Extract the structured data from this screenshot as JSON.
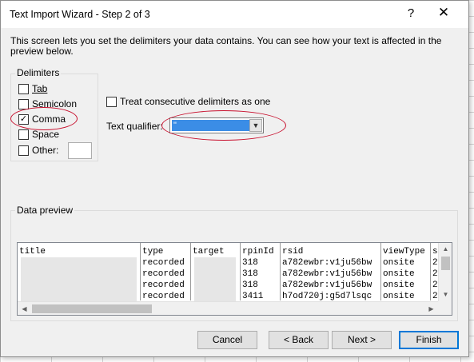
{
  "window": {
    "title": "Text Import Wizard - Step 2 of 3",
    "help_glyph": "?",
    "close_glyph": "✕"
  },
  "description": "This screen lets you set the delimiters your data contains.  You can see how your text is affected in the preview below.",
  "delimiters": {
    "legend": "Delimiters",
    "tab": {
      "label": "Tab",
      "checked": false
    },
    "semicolon": {
      "label": "Semicolon",
      "checked": false
    },
    "comma": {
      "label": "Comma",
      "checked": true
    },
    "space": {
      "label": "Space",
      "checked": false
    },
    "other": {
      "label": "Other:",
      "checked": false,
      "value": ""
    }
  },
  "consecutive": {
    "label": "Treat consecutive delimiters as one",
    "checked": false
  },
  "qualifier": {
    "label": "Text qualifier:",
    "value": "\""
  },
  "preview": {
    "legend": "Data preview",
    "columns": [
      "title",
      "type",
      "target",
      "rpinId",
      "rsid",
      "viewType",
      "s"
    ],
    "rows": [
      [
        "",
        "recorded",
        "",
        "318",
        "a782ewbr:v1ju56bw",
        "onsite",
        "2"
      ],
      [
        "",
        "recorded",
        "",
        "318",
        "a782ewbr:v1ju56bw",
        "onsite",
        "2"
      ],
      [
        "",
        "recorded",
        "",
        "318",
        "a782ewbr:v1ju56bw",
        "onsite",
        "2"
      ],
      [
        "",
        "recorded",
        "",
        "3411",
        "h7od720j:g5d7lsqc",
        "onsite",
        "2"
      ]
    ]
  },
  "buttons": {
    "cancel": "Cancel",
    "back": "< Back",
    "next": "Next >",
    "finish": "Finish"
  },
  "colors": {
    "annotation": "#c8102e",
    "selection": "#3b8de6",
    "default_button_border": "#0078d7"
  }
}
